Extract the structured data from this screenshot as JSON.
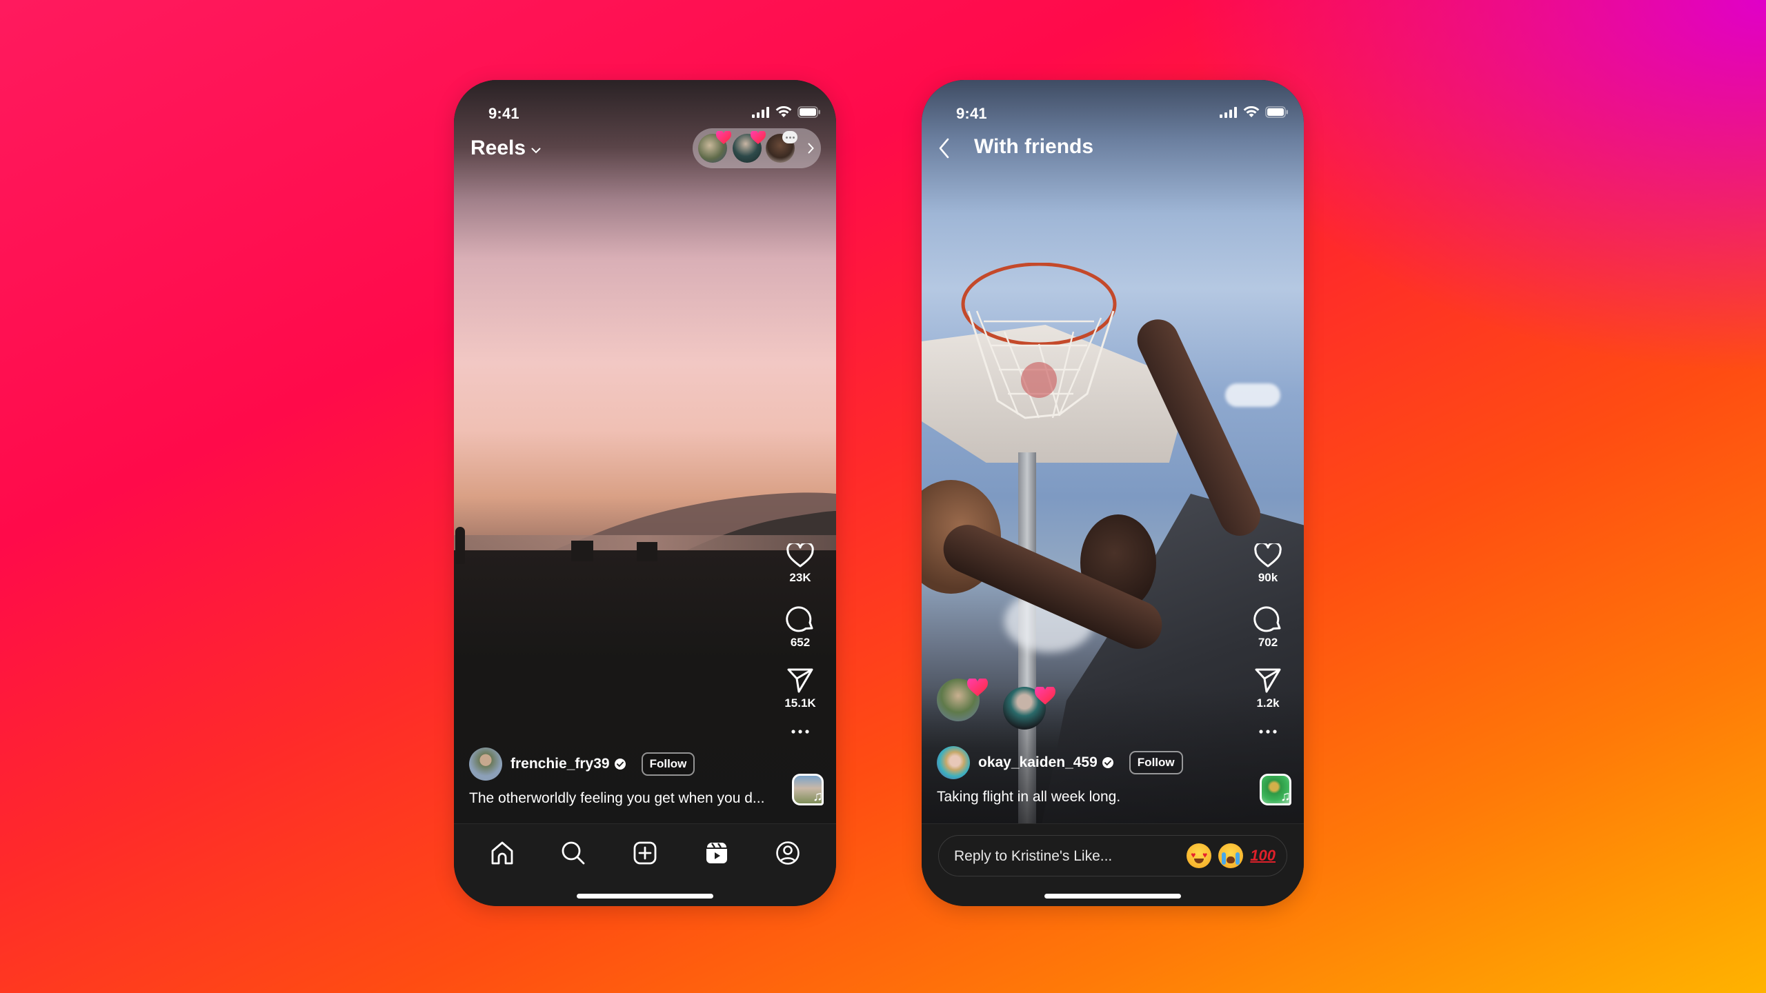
{
  "background": {
    "gradient_colors": [
      "#ff1a5e",
      "#ff2a2a",
      "#ff7a08",
      "#ffb300",
      "#e000c8"
    ]
  },
  "phones": [
    {
      "status_bar": {
        "time": "9:41",
        "icons": [
          "cellular-signal-icon",
          "wifi-icon",
          "battery-icon"
        ]
      },
      "header": {
        "title": "Reels",
        "dropdown_icon": "chevron-down-icon"
      },
      "friend_activity_pill": {
        "avatars": [
          {
            "badge": "heart"
          },
          {
            "badge": "heart"
          },
          {
            "badge": "message-bubble"
          }
        ],
        "chevron_icon": "chevron-right-icon"
      },
      "actions": [
        {
          "icon": "heart-icon",
          "count": "23K"
        },
        {
          "icon": "comment-icon",
          "count": "652"
        },
        {
          "icon": "send-icon",
          "count": "15.1K"
        },
        {
          "icon": "more-icon",
          "count": ""
        }
      ],
      "post": {
        "username": "frenchie_fry39",
        "verified": true,
        "follow_label": "Follow",
        "caption": "The otherworldly feeling you get when you d..."
      },
      "bottom_nav": [
        {
          "icon": "home-icon",
          "label": "Home"
        },
        {
          "icon": "search-icon",
          "label": "Search"
        },
        {
          "icon": "create-icon",
          "label": "Create"
        },
        {
          "icon": "reels-icon",
          "label": "Reels",
          "active": true
        },
        {
          "icon": "profile-icon",
          "label": "Profile"
        }
      ]
    },
    {
      "status_bar": {
        "time": "9:41",
        "icons": [
          "cellular-signal-icon",
          "wifi-icon",
          "battery-icon"
        ]
      },
      "header": {
        "title": "With friends",
        "back_icon": "chevron-left-icon"
      },
      "friend_reactions": [
        {
          "badge": "heart"
        },
        {
          "badge": "heart"
        }
      ],
      "actions": [
        {
          "icon": "heart-icon",
          "count": "90k"
        },
        {
          "icon": "comment-icon",
          "count": "702"
        },
        {
          "icon": "send-icon",
          "count": "1.2k"
        },
        {
          "icon": "more-icon",
          "count": ""
        }
      ],
      "post": {
        "username": "okay_kaiden_459",
        "verified": true,
        "follow_label": "Follow",
        "caption": "Taking flight in all week long."
      },
      "reply_bar": {
        "placeholder": "Reply to Kristine's Like...",
        "quick_reactions": [
          "😍",
          "😭",
          "💯"
        ]
      }
    }
  ]
}
